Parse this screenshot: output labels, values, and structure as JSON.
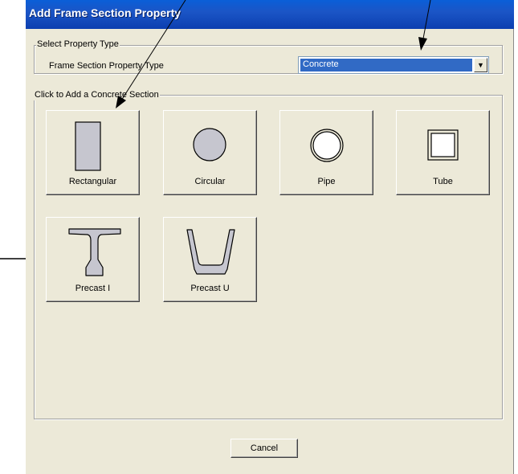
{
  "window": {
    "title": "Add Frame Section Property"
  },
  "property_type_group": {
    "legend": "Select Property Type",
    "field_label": "Frame Section Property Type",
    "selected_value": "Concrete"
  },
  "sections_group": {
    "legend": "Click to Add a Concrete Section",
    "buttons": [
      {
        "label": "Rectangular",
        "icon": "rectangle-section-icon"
      },
      {
        "label": "Circular",
        "icon": "circle-section-icon"
      },
      {
        "label": "Pipe",
        "icon": "pipe-section-icon"
      },
      {
        "label": "Tube",
        "icon": "tube-section-icon"
      },
      {
        "label": "Precast I",
        "icon": "precast-i-section-icon"
      },
      {
        "label": "Precast U",
        "icon": "precast-u-section-icon"
      }
    ]
  },
  "footer": {
    "cancel_label": "Cancel"
  },
  "colors": {
    "titlebar": "#0c3fb0",
    "dialog_bg": "#ece9d8",
    "selection": "#316ac5",
    "shape_fill": "#c6c6cf"
  }
}
